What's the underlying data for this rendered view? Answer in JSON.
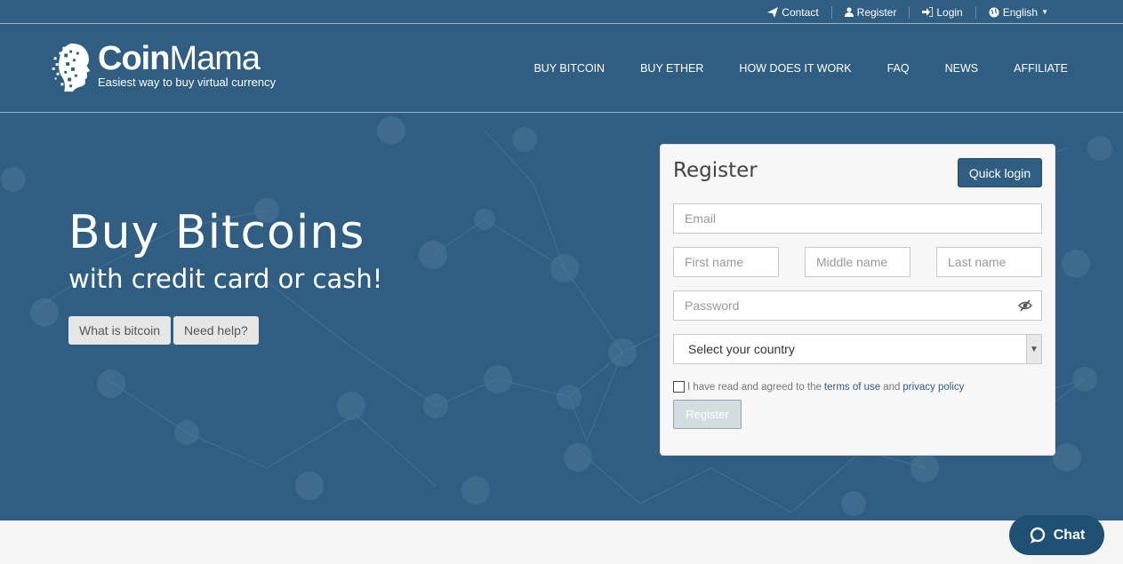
{
  "topbar": {
    "contact": "Contact",
    "register": "Register",
    "login": "Login",
    "language": "English"
  },
  "brand": {
    "name_bold": "Coin",
    "name_thin": "Mama",
    "tagline": "Easiest way to buy virtual currency"
  },
  "nav": {
    "items": [
      "BUY BITCOIN",
      "BUY ETHER",
      "HOW DOES IT WORK",
      "FAQ",
      "NEWS",
      "AFFILIATE"
    ]
  },
  "hero": {
    "title": "Buy Bitcoins",
    "subtitle": "with credit card or cash!",
    "btn_what": "What is bitcoin",
    "btn_help": "Need help?"
  },
  "register": {
    "title": "Register",
    "quick_login": "Quick login",
    "email_placeholder": "Email",
    "first_placeholder": "First name",
    "middle_placeholder": "Middle name",
    "last_placeholder": "Last name",
    "password_placeholder": "Password",
    "country_value": "Select your country",
    "agree_prefix": "I have read and agreed to the",
    "terms": "terms of use",
    "and": "and",
    "privacy": "privacy policy",
    "submit": "Register"
  },
  "chat": {
    "label": "Chat"
  },
  "colors": {
    "brand_blue": "#2f5e82",
    "chat_bg": "#1f4f72"
  }
}
